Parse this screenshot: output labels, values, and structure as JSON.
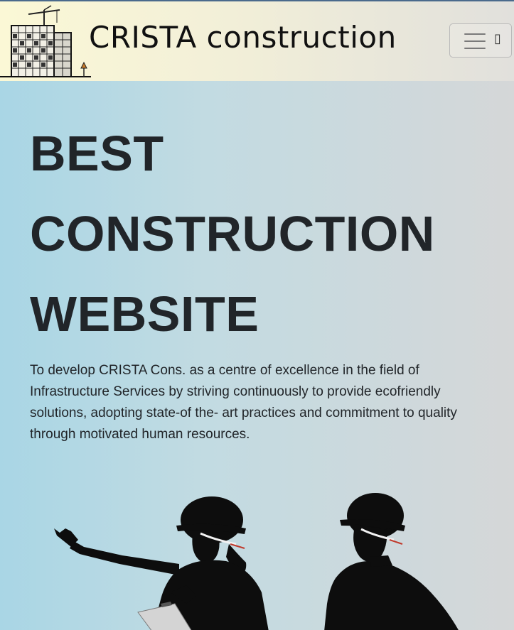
{
  "navbar": {
    "brand": "CRISTA construction",
    "logo_icon": "building-crane-icon",
    "toggler_icon": "hamburger-menu-icon",
    "toggler_glyph": "▯"
  },
  "hero": {
    "headline_lines": [
      "BEST",
      "CONSTRUCTION",
      "WEBSITE"
    ],
    "mission": "To develop CRISTA Cons. as a centre of excellence in the field of Infrastructure Services by striving continuously to provide ecofriendly solutions, adopting state-of the- art practices and commitment to quality through motivated human resources.",
    "illustration_icon": "construction-workers-silhouette-icon"
  },
  "colors": {
    "text": "#212529",
    "hero_gradient_start": "#a9d6e5",
    "hero_gradient_end": "#d5d7d8",
    "navbar_gradient_start": "#fbf8d6",
    "navbar_gradient_end": "#e1e0dc"
  }
}
